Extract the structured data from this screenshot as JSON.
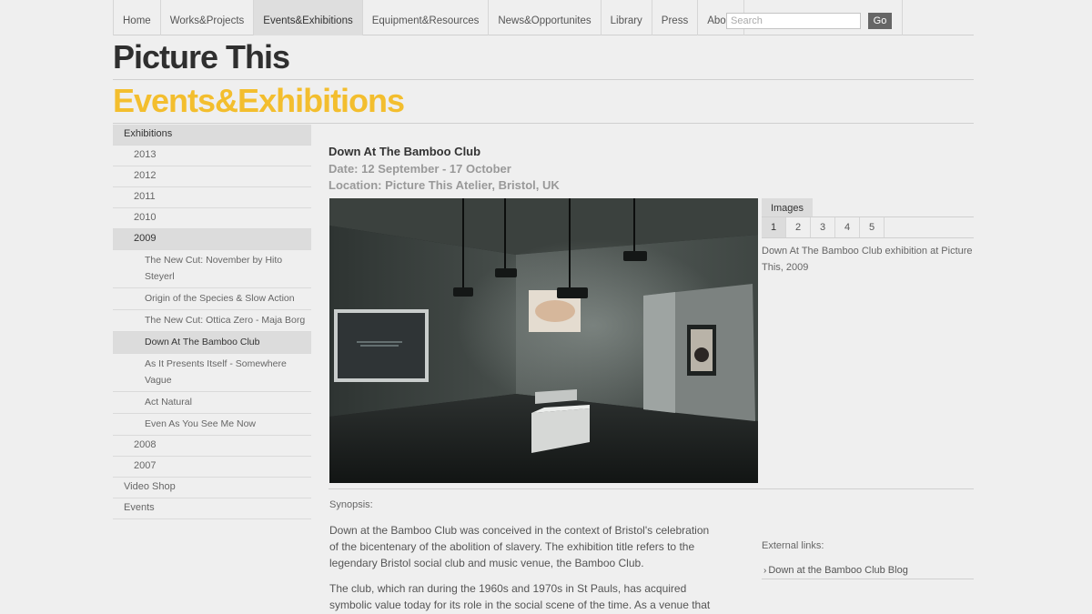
{
  "nav": {
    "tabs": [
      "Home",
      "Works&Projects",
      "Events&Exhibitions",
      "Equipment&Resources",
      "News&Opportunites",
      "Library",
      "Press",
      "About"
    ],
    "active_index": 2,
    "search_placeholder": "Search",
    "go_label": "Go"
  },
  "header": {
    "site_title": "Picture This",
    "section_title": "Events&Exhibitions"
  },
  "sidebar": {
    "exhibitions": "Exhibitions",
    "y2013": "2013",
    "y2012": "2012",
    "y2011": "2011",
    "y2010": "2010",
    "y2009": "2009",
    "sub": [
      "The New Cut: November by Hito Steyerl",
      "Origin of the Species & Slow Action",
      "The New Cut: Ottica Zero - Maja Borg",
      "Down At The Bamboo Club",
      "As It Presents Itself - Somewhere Vague",
      "Act Natural",
      "Even As You See Me Now"
    ],
    "y2008": "2008",
    "y2007": "2007",
    "video_shop": "Video Shop",
    "events": "Events"
  },
  "event": {
    "title": "Down At The Bamboo Club",
    "date": "Date: 12 September - 17 October",
    "location": "Location: Picture This Atelier, Bristol, UK"
  },
  "images": {
    "tab_label": "Images",
    "pages": [
      "1",
      "2",
      "3",
      "4",
      "5"
    ],
    "current_page": 1,
    "caption": "Down At The Bamboo Club exhibition at Picture This, 2009"
  },
  "synopsis": {
    "label": "Synopsis:",
    "p1": "Down at the Bamboo Club was conceived in the context of Bristol's celebration of the bicentenary of the abolition of slavery. The exhibition title refers to the legendary Bristol social club and music venue, the Bamboo Club.",
    "p2": "The club, which ran during the 1960s and 1970s in St Pauls, has acquired symbolic value today for its role in the social scene of the time. As a venue that"
  },
  "external": {
    "label": "External links:",
    "link1": "Down at the Bamboo Club Blog"
  },
  "colors": {
    "accent_yellow": "#f3be2e",
    "title_dark": "#2f2f2f",
    "background": "#efefef"
  }
}
